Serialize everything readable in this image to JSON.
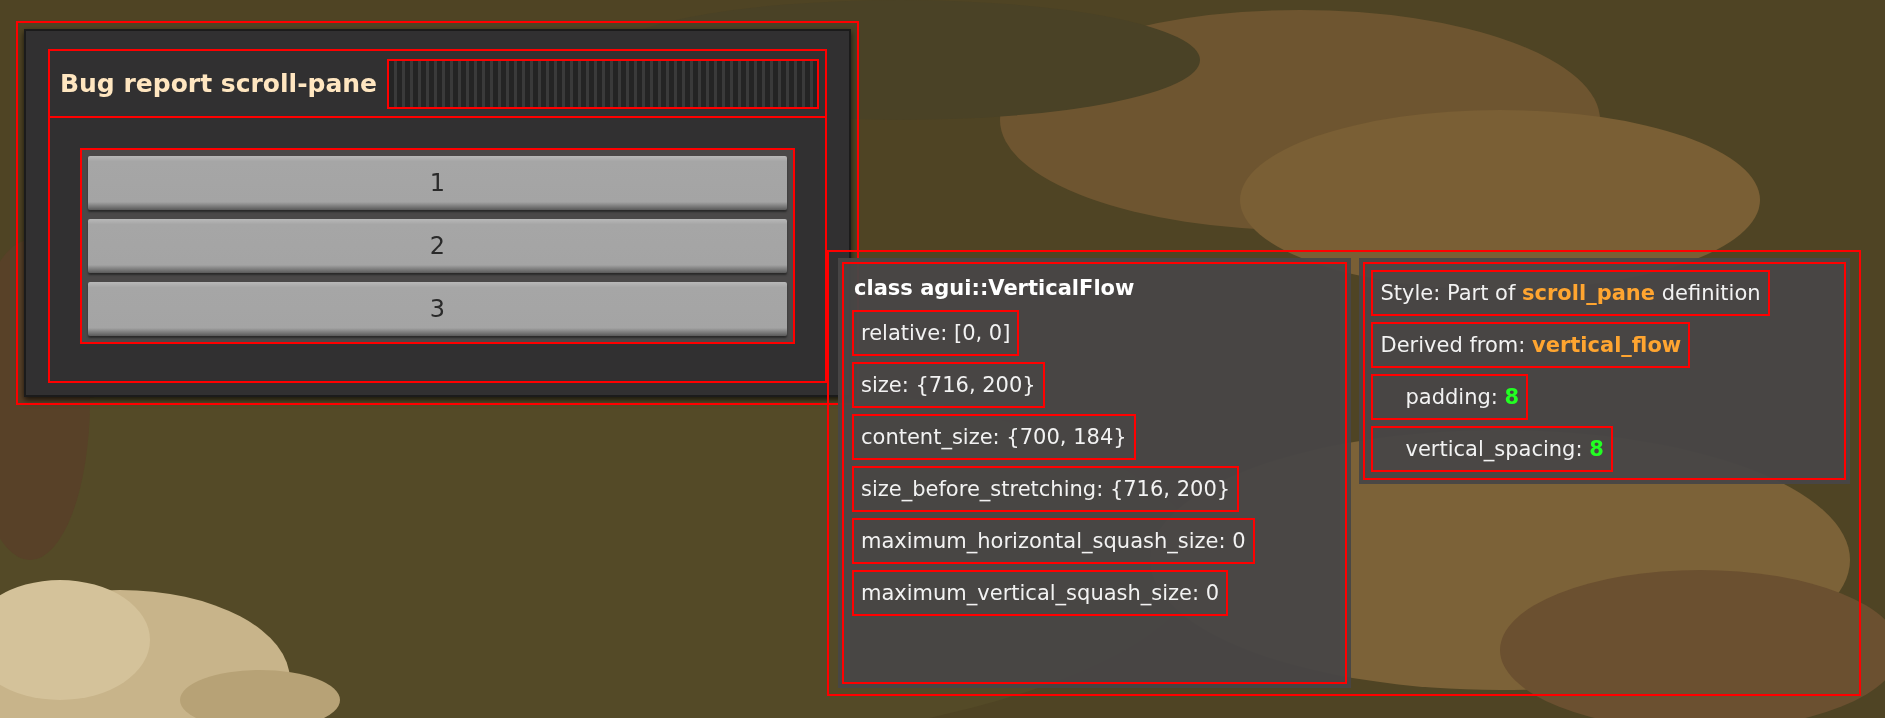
{
  "window": {
    "title": "Bug report scroll-pane"
  },
  "buttons": [
    {
      "label": "1"
    },
    {
      "label": "2"
    },
    {
      "label": "3"
    }
  ],
  "inspector": {
    "class_name": "class agui::VerticalFlow",
    "properties": [
      "relative: [0, 0]",
      "size: {716, 200}",
      "content_size: {700, 184}",
      "size_before_stretching: {716, 200}",
      "maximum_horizontal_squash_size: 0",
      "maximum_vertical_squash_size: 0"
    ],
    "style_lines": [
      {
        "kind": "reference",
        "text": "Style: Part of **scroll_pane** definition"
      },
      {
        "kind": "reference",
        "text": "Derived from: **vertical_flow**"
      },
      {
        "kind": "setting",
        "text": "padding: **8**"
      },
      {
        "kind": "setting",
        "text": "vertical_spacing: **8**"
      }
    ]
  }
}
